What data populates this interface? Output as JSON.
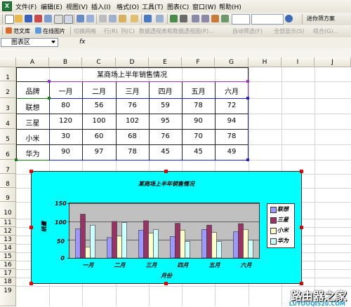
{
  "menubar": {
    "items": [
      "文件(F)",
      "编辑(E)",
      "视图(V)",
      "插入(I)",
      "格式(O)",
      "工具(T)",
      "图表(C)",
      "窗口(W)",
      "帮助(H)"
    ]
  },
  "toolbar": {
    "help_box_text": "迷你筛方案"
  },
  "toolbar2": {
    "items": [
      "范文库",
      "在线图片",
      "切换网格",
      "行(R)",
      "列(C)",
      "数据透视表和数据透视图(P)...",
      "自动筛选(F)",
      "全部显示(S)",
      "组合(G)..."
    ]
  },
  "formula_bar": {
    "name_box": "图表区",
    "fx": "fx"
  },
  "columns": [
    "A",
    "B",
    "C",
    "D",
    "E",
    "F",
    "G",
    "H",
    "I",
    "J"
  ],
  "rows": [
    "1",
    "2",
    "3",
    "4",
    "5",
    "6",
    "7",
    "8",
    "9",
    "10",
    "11",
    "12",
    "13",
    "14",
    "15",
    "16",
    "17",
    "18",
    "19"
  ],
  "sheet": {
    "title": "某商场上半年销售情况",
    "header": [
      "品牌",
      "一月",
      "二月",
      "三月",
      "四月",
      "五月",
      "六月"
    ],
    "data": [
      [
        "联想",
        "80",
        "56",
        "76",
        "59",
        "78",
        "72"
      ],
      [
        "三星",
        "120",
        "100",
        "102",
        "95",
        "90",
        "94"
      ],
      [
        "小米",
        "30",
        "60",
        "68",
        "76",
        "70",
        "78"
      ],
      [
        "华为",
        "90",
        "97",
        "78",
        "45",
        "45",
        "49"
      ]
    ]
  },
  "chart_data": {
    "type": "bar",
    "title": "某商场上半年销售情况",
    "xlabel": "月份",
    "ylabel": "销量",
    "categories": [
      "一月",
      "二月",
      "三月",
      "四月",
      "五月",
      "六月"
    ],
    "series": [
      {
        "name": "联想",
        "color": "#9999ff",
        "values": [
          80,
          56,
          76,
          59,
          78,
          72
        ]
      },
      {
        "name": "三星",
        "color": "#993366",
        "values": [
          120,
          100,
          102,
          95,
          90,
          94
        ]
      },
      {
        "name": "小米",
        "color": "#ffffcc",
        "values": [
          30,
          60,
          68,
          76,
          70,
          78
        ]
      },
      {
        "name": "华为",
        "color": "#ccffff",
        "values": [
          90,
          97,
          78,
          45,
          45,
          49
        ]
      }
    ],
    "yticks": [
      "150",
      "100",
      "50",
      "0"
    ],
    "ylim": [
      0,
      150
    ],
    "legend_position": "right",
    "chart_area_color": "#00ffff",
    "plot_area_color": "#c0c0c0"
  },
  "watermark": {
    "text": "路由器之家",
    "url": "LUYOUQI520.COM"
  }
}
